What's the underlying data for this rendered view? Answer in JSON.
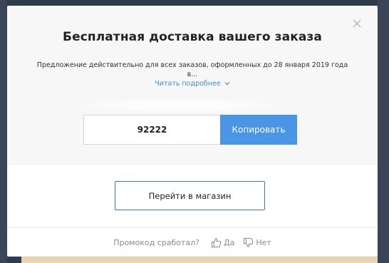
{
  "colors": {
    "accent": "#4a96e6",
    "link": "#3b8de0",
    "shop_border": "#3f78b8",
    "backdrop": "#2f3a4b"
  },
  "modal": {
    "title": "Бесплатная доставка вашего заказа",
    "description": "Предложение действительно для всех заказов, оформленных до 28 января 2019 года в...",
    "read_more": "Читать подробнее",
    "close_icon": "close-icon",
    "promo_code": "92222",
    "copy_label": "Копировать",
    "shop_label": "Перейти в магазин",
    "feedback": {
      "question": "Промокод сработал?",
      "yes_label": "Да",
      "no_label": "Нет",
      "yes_icon": "thumbs-up-icon",
      "no_icon": "thumbs-down-icon"
    }
  }
}
